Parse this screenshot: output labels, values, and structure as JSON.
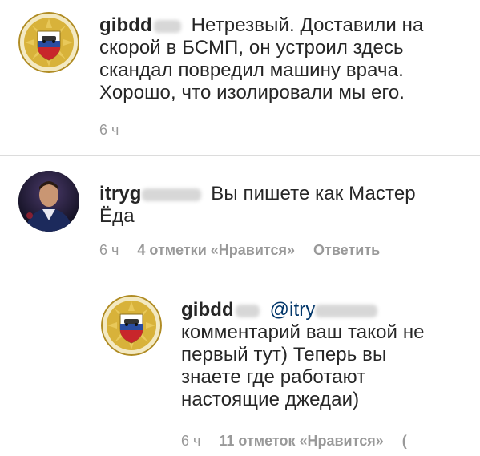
{
  "comments": [
    {
      "username": "gibdd",
      "text_lines": [
        "Нетрезвый.  Доставили  на",
        "скорой в БСМП, он устроил здесь",
        "скандал повредил машину врача.",
        "Хорошо, что изолировали мы его."
      ],
      "time": "6 ч"
    },
    {
      "username": "itryg",
      "text_lines": [
        "Вы пишете как Мастер",
        "Ёда"
      ],
      "time": "6 ч",
      "likes": "4 отметки «Нравится»",
      "reply_label": "Ответить"
    },
    {
      "username": "gibdd",
      "mention": "@itry",
      "text_lines": [
        "комментарий ваш такой не",
        "первый тут) Теперь вы",
        "знаете где работают",
        "настоящие джедаи)"
      ],
      "time": "6 ч",
      "likes": "11 отметок «Нравится»",
      "reply_label_cut": "("
    }
  ],
  "colors": {
    "text": "#262626",
    "meta": "#999999",
    "mention": "#003569",
    "divider": "#dcdcdc",
    "badge_gold": "#d8b23a",
    "badge_blue": "#2a4da0",
    "badge_red": "#c8262b"
  },
  "icons": {
    "gibdd_avatar": "gibdd-emblem-icon",
    "user_avatar": "user-photo-avatar"
  }
}
